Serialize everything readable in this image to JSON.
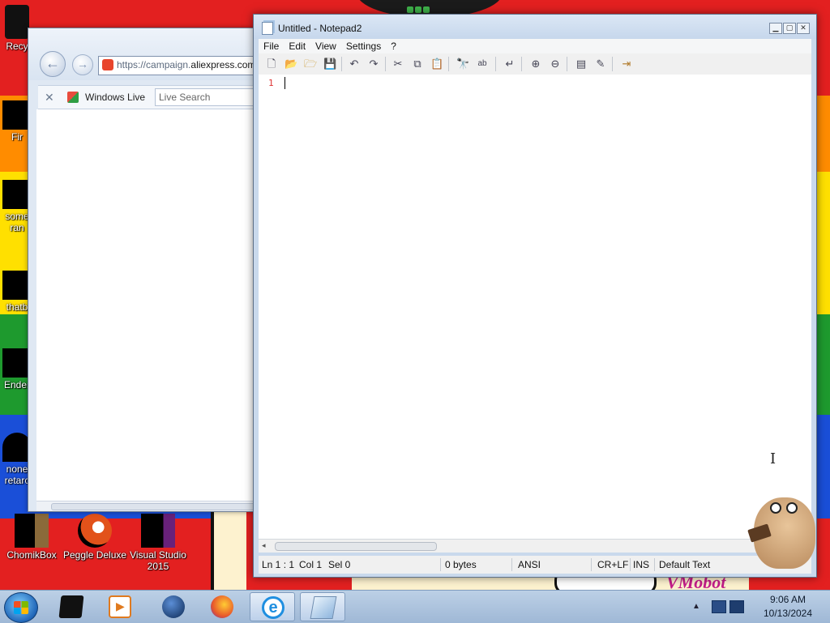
{
  "desktop": {
    "icons": [
      {
        "label": "Recy"
      },
      {
        "label": "Fir"
      },
      {
        "label": "some",
        "label2": "ran"
      },
      {
        "label": "thatb"
      },
      {
        "label": "Ender"
      },
      {
        "label": "none",
        "label2": "retarc"
      },
      {
        "label": "ChomikBox"
      },
      {
        "label": "Peggle Deluxe"
      },
      {
        "label": "Visual Studio",
        "label2": "2015"
      }
    ],
    "watermark": "VMobot"
  },
  "ie": {
    "url_prefix": "https://campaign.",
    "url_domain": "aliexpress.com",
    "toolbar_close": "✕",
    "windows_live_label": "Windows Live",
    "search_placeholder": "Live Search"
  },
  "notepad": {
    "title": "Untitled - Notepad2",
    "menu": [
      "File",
      "Edit",
      "View",
      "Settings",
      "?"
    ],
    "line_number": "1",
    "status": {
      "position": "Ln 1 : 1",
      "column": "Col 1",
      "selection": "Sel 0",
      "size": "0 bytes",
      "encoding": "ANSI",
      "line_endings": "CR+LF",
      "insert_mode": "INS",
      "scheme": "Default Text"
    }
  },
  "taskbar": {
    "time": "9:06 AM",
    "date": "10/13/2024",
    "buttons": [
      "app-1",
      "media-player",
      "network-globe",
      "firefox",
      "internet-explorer",
      "notepad2"
    ]
  },
  "colors": {
    "accent": "#1a4fd8",
    "line_number": "#dd3333"
  }
}
